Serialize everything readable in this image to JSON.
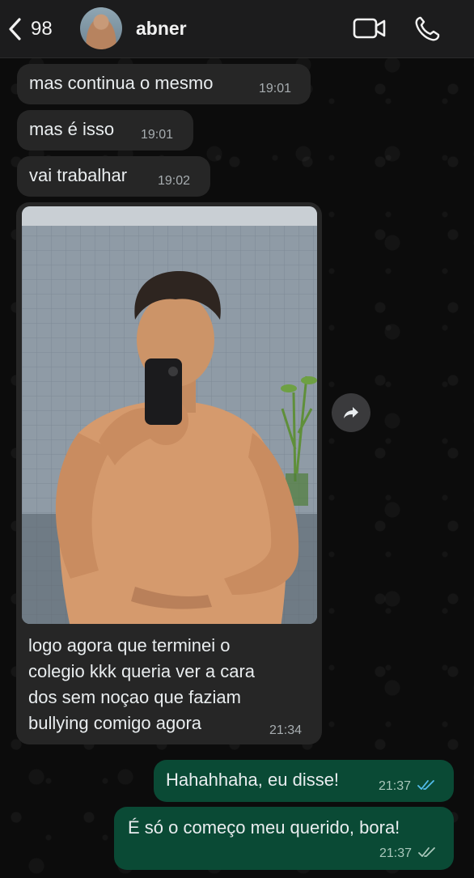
{
  "header": {
    "back_count": "98",
    "contact_name": "abner",
    "icons": [
      "chevron-left-icon",
      "video-camera-icon",
      "phone-icon"
    ]
  },
  "messages": [
    {
      "direction": "in",
      "text": "mas continua o mesmo",
      "time": "19:01"
    },
    {
      "direction": "in",
      "text": "mas é isso",
      "time": "19:01"
    },
    {
      "direction": "in",
      "text": "vai trabalhar",
      "time": "19:02"
    },
    {
      "direction": "in",
      "type": "photo",
      "caption_lines": [
        "logo agora que terminei o",
        "colegio kkk queria ver a cara",
        "dos sem noçao que faziam",
        "bullying comigo agora"
      ],
      "time": "21:34"
    },
    {
      "direction": "out",
      "text": "Hahahhaha, eu disse!",
      "time": "21:37",
      "status": "read"
    },
    {
      "direction": "out",
      "text": "É só o começo meu querido, bora!",
      "time": "21:37",
      "status": "delivered"
    }
  ],
  "colors": {
    "header_bg": "#1c1c1d",
    "incoming_bubble": "#262626",
    "outgoing_bubble": "#0a4a35",
    "read_ticks": "#53bdeb",
    "delivered_ticks": "#a9c7bb"
  }
}
